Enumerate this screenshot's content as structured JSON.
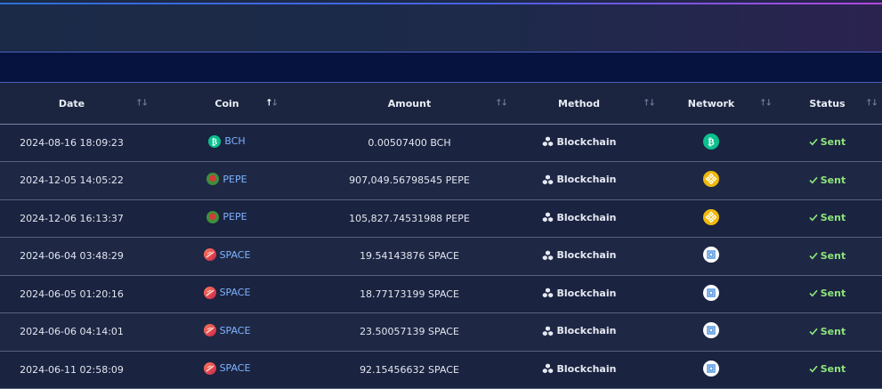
{
  "colors": {
    "accent_sent": "#8ee57a",
    "coin_link": "#7fb3ff",
    "bch": "#0ac18e",
    "bsc": "#f0b90b",
    "space": "#e5484d"
  },
  "columns": [
    {
      "label": "Date"
    },
    {
      "label": "Coin"
    },
    {
      "label": "Amount"
    },
    {
      "label": "Method"
    },
    {
      "label": "Network"
    },
    {
      "label": "Status"
    }
  ],
  "rows": [
    {
      "date": "2024-08-16 18:09:23",
      "coin": "BCH",
      "amount": "0.00507400 BCH",
      "method": "Blockchain",
      "network": "bch-icon",
      "status": "Sent"
    },
    {
      "date": "2024-12-05 14:05:22",
      "coin": "PEPE",
      "amount": "907,049.56798545 PEPE",
      "method": "Blockchain",
      "network": "bsc-icon",
      "status": "Sent"
    },
    {
      "date": "2024-12-06 16:13:37",
      "coin": "PEPE",
      "amount": "105,827.74531988 PEPE",
      "method": "Blockchain",
      "network": "bsc-icon",
      "status": "Sent"
    },
    {
      "date": "2024-06-04 03:48:29",
      "coin": "SPACE",
      "amount": "19.54143876 SPACE",
      "method": "Blockchain",
      "network": "space-network-icon",
      "status": "Sent"
    },
    {
      "date": "2024-06-05 01:20:16",
      "coin": "SPACE",
      "amount": "18.77173199 SPACE",
      "method": "Blockchain",
      "network": "space-network-icon",
      "status": "Sent"
    },
    {
      "date": "2024-06-06 04:14:01",
      "coin": "SPACE",
      "amount": "23.50057139 SPACE",
      "method": "Blockchain",
      "network": "space-network-icon",
      "status": "Sent"
    },
    {
      "date": "2024-06-11 02:58:09",
      "coin": "SPACE",
      "amount": "92.15456632 SPACE",
      "method": "Blockchain",
      "network": "space-network-icon",
      "status": "Sent"
    }
  ]
}
